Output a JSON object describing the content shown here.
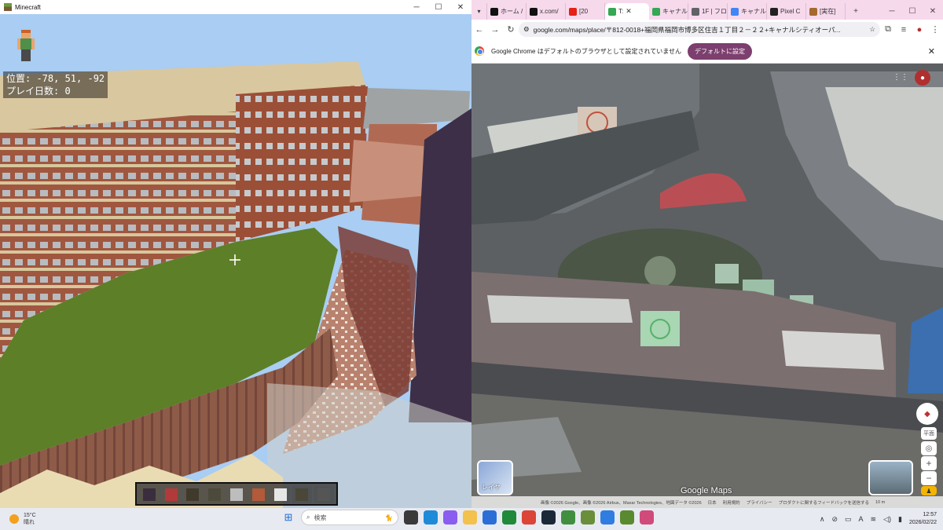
{
  "minecraft": {
    "window_title": "Minecraft",
    "hud": {
      "position": "位置: -78, 51, -92",
      "days": "プレイ日数: 0"
    },
    "hotbar": {
      "selected_index": 6,
      "slots": [
        "#3a2e3e",
        "#b23a3a",
        "#3f3a2c",
        "#4c4a3a",
        "#bdbdbd",
        "#b25a3a",
        "#e6e6e6",
        "#4a4738",
        "#555555"
      ]
    }
  },
  "chrome": {
    "tabs": [
      {
        "label": "ホーム /",
        "icon": "x-icon",
        "color": "#111111"
      },
      {
        "label": "x.com/",
        "icon": "x-icon",
        "color": "#111111"
      },
      {
        "label": "[20",
        "icon": "youtube-icon",
        "color": "#e62117"
      },
      {
        "label": "T:",
        "icon": "maps-pin-icon",
        "color": "#34a853",
        "active": true
      },
      {
        "label": "キャナル",
        "icon": "maps-pin-icon",
        "color": "#34a853"
      },
      {
        "label": "1F | フロ",
        "icon": "globe-icon",
        "color": "#5f6368"
      },
      {
        "label": "キャナル",
        "icon": "google-icon",
        "color": "#4285f4"
      },
      {
        "label": "Pixel C",
        "icon": "pencil-icon",
        "color": "#222222"
      },
      {
        "label": "[実在]",
        "icon": "mii-icon",
        "color": "#a5692e"
      }
    ],
    "url": "google.com/maps/place/〒812-0018+福岡県福岡市博多区住吉１丁目２－２２+キャナルシティオーパ...",
    "infobar_text": "Google Chrome はデフォルトのブラウザとして設定されていません",
    "set_default_label": "デフォルトに設定",
    "map": {
      "brand": "Google Maps",
      "layer_label": "レイヤ",
      "attribution": [
        "画像 ©2026 Google、画像 ©2026 Airbus、Maxar Technologies、地図データ ©2026",
        "日本",
        "利用規約",
        "プライバシー",
        "プロダクトに関するフィードバックを送信する",
        "10 m"
      ],
      "label_3d": "平面"
    }
  },
  "taskbar": {
    "weather_temp": "15°C",
    "weather_desc": "晴れ",
    "search_placeholder": "検索",
    "time": "12:57",
    "date": "2026/02/22",
    "apps": [
      {
        "name": "file-manager-icon",
        "color": "#3a3a3a"
      },
      {
        "name": "edge-icon",
        "color": "#1f8ad8"
      },
      {
        "name": "copilot-icon",
        "color": "#8a5cf0"
      },
      {
        "name": "folder-icon",
        "color": "#f2c14e"
      },
      {
        "name": "store-icon",
        "color": "#2b6fd6"
      },
      {
        "name": "xbox-icon",
        "color": "#1f8a3a"
      },
      {
        "name": "chrome-icon",
        "color": "#db4437"
      },
      {
        "name": "steam-icon",
        "color": "#1b2838"
      },
      {
        "name": "creeper-icon",
        "color": "#3f8f3f"
      },
      {
        "name": "minecraft-icon",
        "color": "#6b8e3a"
      },
      {
        "name": "notepad-icon",
        "color": "#2f7de1"
      },
      {
        "name": "grass-block-icon",
        "color": "#5a8a30"
      },
      {
        "name": "photos-icon",
        "color": "#d04a7a"
      }
    ]
  }
}
